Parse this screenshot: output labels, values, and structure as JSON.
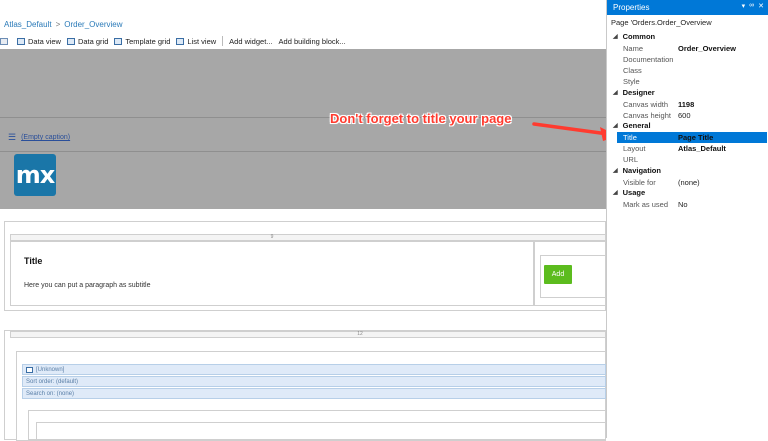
{
  "breadcrumb": {
    "items": [
      "Atlas_Default",
      "Order_Overview"
    ],
    "separator": ">"
  },
  "toolbar": {
    "items": [
      {
        "label": "Data view",
        "icon": "data-view-icon"
      },
      {
        "label": "Data grid",
        "icon": "data-grid-icon"
      },
      {
        "label": "Template grid",
        "icon": "template-grid-icon"
      },
      {
        "label": "List view",
        "icon": "list-view-icon"
      }
    ],
    "add_widget": "Add widget...",
    "add_building_block": "Add building block..."
  },
  "canvas": {
    "empty_caption": "(Empty caption)",
    "logo_text": "mx",
    "section1_col": "9",
    "title": "Title",
    "subtitle": "Here you can put a paragraph as subtitle",
    "add_button": "Add",
    "section2_col": "12",
    "unknown_label": "[Unknown]",
    "sort_order": "Sort order: (default)",
    "search_on": "Search on: (none)"
  },
  "annotation": {
    "text": "Don't forget to title your page",
    "color": "#ff3b2f"
  },
  "properties": {
    "panel_title": "Properties",
    "subject": "Page 'Orders.Order_Overview",
    "categories": {
      "common": "Common",
      "designer": "Designer",
      "general": "General",
      "navigation": "Navigation",
      "usage": "Usage"
    },
    "rows": {
      "name": {
        "label": "Name",
        "value": "Order_Overview"
      },
      "documentation": {
        "label": "Documentation",
        "value": ""
      },
      "class": {
        "label": "Class",
        "value": ""
      },
      "style": {
        "label": "Style",
        "value": ""
      },
      "canvas_width": {
        "label": "Canvas width",
        "value": "1198"
      },
      "canvas_height": {
        "label": "Canvas height",
        "value": "600"
      },
      "title": {
        "label": "Title",
        "value": "Page Title"
      },
      "layout": {
        "label": "Layout",
        "value": "Atlas_Default"
      },
      "url": {
        "label": "URL",
        "value": ""
      },
      "visible_for": {
        "label": "Visible for",
        "value": "(none)"
      },
      "mark_as_used": {
        "label": "Mark as used",
        "value": "No"
      }
    }
  },
  "colors": {
    "accent": "#0078d7",
    "success": "#5cbc1e",
    "canvas_gray": "#a7a7a7",
    "logo_blue": "#1a76a8"
  }
}
